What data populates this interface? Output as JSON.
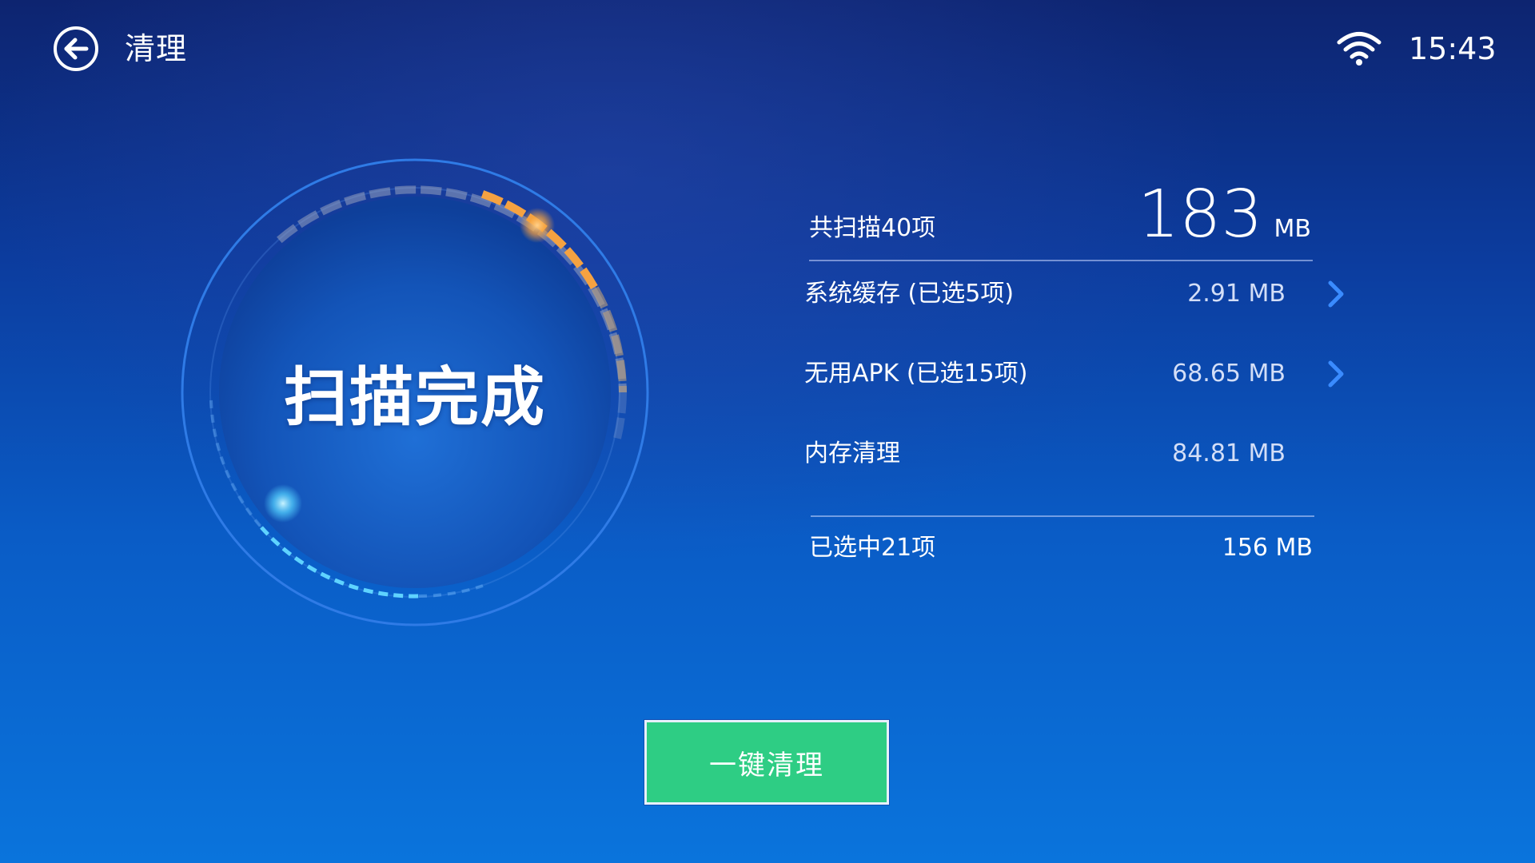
{
  "header": {
    "title": "清理",
    "time": "15:43",
    "back_icon": "back-arrow-icon",
    "status_icon": "wifi-icon"
  },
  "gauge": {
    "status_text": "扫描完成"
  },
  "summary": {
    "label": "共扫描40项",
    "total_value": "183",
    "total_unit": "MB"
  },
  "items": [
    {
      "label": "系统缓存 (已选5项)",
      "size": "2.91 MB",
      "has_chevron": true
    },
    {
      "label": "无用APK (已选15项)",
      "size": "68.65 MB",
      "has_chevron": true
    },
    {
      "label": "内存清理",
      "size": "84.81 MB",
      "has_chevron": false
    }
  ],
  "selected": {
    "label": "已选中21项",
    "size": "156 MB"
  },
  "actions": {
    "clean_label": "一键清理"
  },
  "colors": {
    "button": "#2ecd84",
    "accent_orange": "#f7a33c",
    "accent_cyan": "#5fd3ff",
    "chevron": "#3a8bff"
  }
}
